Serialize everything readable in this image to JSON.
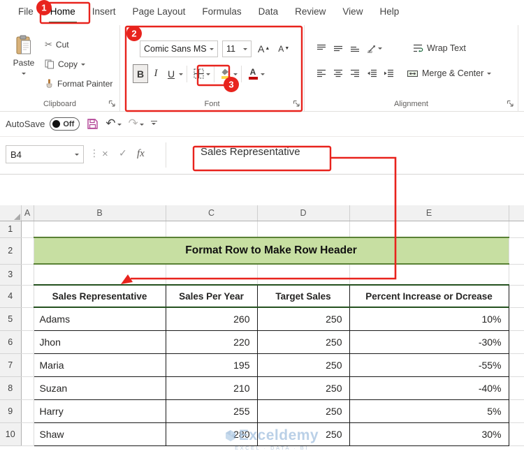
{
  "badges": {
    "one": "1",
    "two": "2",
    "three": "3"
  },
  "menu": {
    "tabs": [
      {
        "label": "File"
      },
      {
        "label": "Home"
      },
      {
        "label": "Insert"
      },
      {
        "label": "Page Layout"
      },
      {
        "label": "Formulas"
      },
      {
        "label": "Data"
      },
      {
        "label": "Review"
      },
      {
        "label": "View"
      },
      {
        "label": "Help"
      }
    ]
  },
  "ribbon": {
    "clipboard": {
      "group_label": "Clipboard",
      "paste_label": "Paste",
      "cut_label": "Cut",
      "copy_label": "Copy",
      "format_painter_label": "Format Painter"
    },
    "font": {
      "group_label": "Font",
      "font_name": "Comic Sans MS",
      "font_size": "11",
      "bold": "B",
      "italic": "I",
      "underline": "U",
      "font_color_letter": "A",
      "grow_letter": "A",
      "shrink_letter": "A"
    },
    "alignment": {
      "group_label": "Alignment",
      "wrap_text_label": "Wrap Text",
      "merge_center_label": "Merge & Center"
    }
  },
  "quick_access": {
    "autosave_label": "AutoSave",
    "autosave_state": "Off"
  },
  "formula_bar": {
    "name_box": "B4",
    "fx_label": "fx",
    "formula_text": "Sales Representative"
  },
  "sheet": {
    "columns": [
      "A",
      "B",
      "C",
      "D",
      "E"
    ],
    "rows": [
      "1",
      "2",
      "3",
      "4",
      "5",
      "6",
      "7",
      "8",
      "9",
      "10"
    ],
    "title": "Format Row to Make Row Header",
    "table": {
      "headers": [
        "Sales Representative",
        "Sales Per Year",
        "Target Sales",
        "Percent Increase or Dcrease"
      ],
      "rows": [
        {
          "name": "Adams",
          "sales": "260",
          "target": "250",
          "percent": "10%"
        },
        {
          "name": "Jhon",
          "sales": "220",
          "target": "250",
          "percent": "-30%"
        },
        {
          "name": "Maria",
          "sales": "195",
          "target": "250",
          "percent": "-55%"
        },
        {
          "name": "Suzan",
          "sales": "210",
          "target": "250",
          "percent": "-40%"
        },
        {
          "name": "Harry",
          "sales": "255",
          "target": "250",
          "percent": "5%"
        },
        {
          "name": "Shaw",
          "sales": "280",
          "target": "250",
          "percent": "30%"
        }
      ]
    },
    "watermark": {
      "name": "Exceldemy",
      "tagline": "EXCEL · DATA · BI"
    }
  },
  "colors": {
    "accent_green": "#1e6b41",
    "annotation_red": "#e8231d",
    "title_fill": "#c7dfa2",
    "header_border": "#24511f",
    "save_icon": "#b13e93"
  }
}
